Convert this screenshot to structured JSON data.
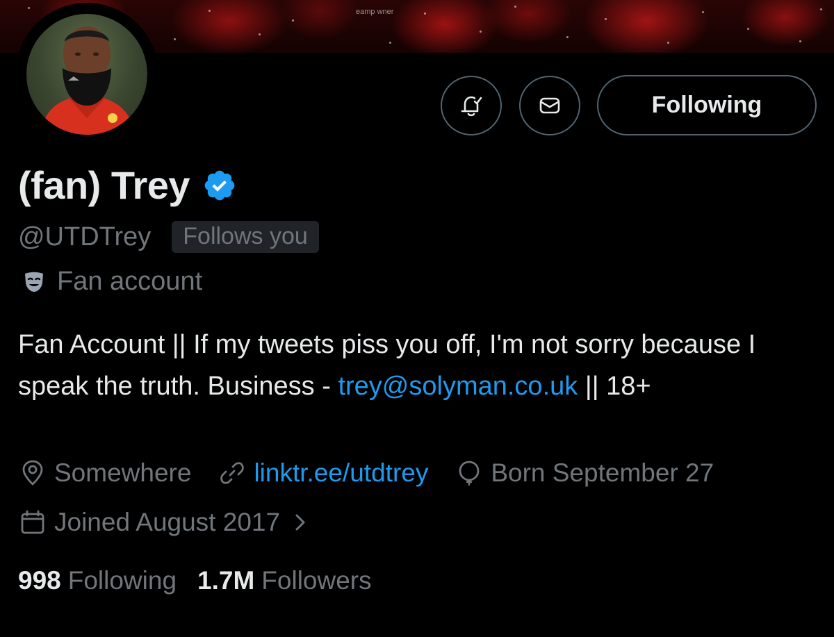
{
  "banner": {
    "sponsor_text": "eamp\nwner"
  },
  "profile": {
    "display_name": "(fan) Trey",
    "verified_icon": "verified-badge-icon",
    "handle": "@UTDTrey",
    "follows_you_badge": "Follows you",
    "account_label": "Fan account",
    "bio_text": "Fan Account || If my tweets piss you off, I'm not sorry because I speak the truth. Business - ",
    "bio_email": "trey@solyman.co.uk",
    "bio_suffix": " || 18+",
    "location": "Somewhere",
    "website": "linktr.ee/utdtrey",
    "birthday": "Born September 27",
    "joined": "Joined August 2017"
  },
  "actions": {
    "notifications_icon": "bell-check-icon",
    "message_icon": "envelope-icon",
    "follow_button_label": "Following"
  },
  "stats": {
    "following_count": "998",
    "following_label": "Following",
    "followers_count": "1.7M",
    "followers_label": "Followers"
  },
  "colors": {
    "background": "#000000",
    "primary_text": "#e7e9ea",
    "secondary_text": "#71767b",
    "link": "#1d9bf0",
    "verified": "#1d9bf0",
    "border": "#536471"
  }
}
